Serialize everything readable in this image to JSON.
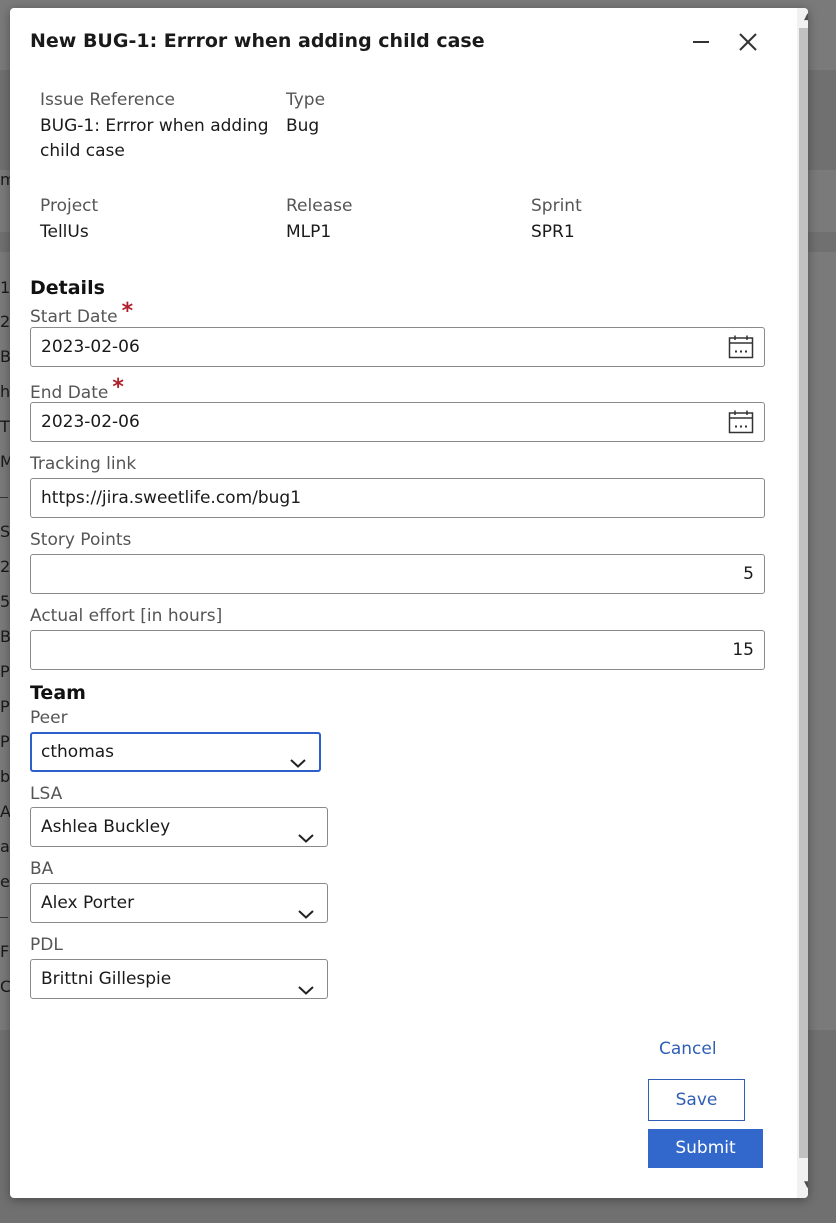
{
  "background": {
    "letters": [
      "m",
      "1",
      "2",
      "B",
      "h",
      "T",
      "M",
      "S",
      "2",
      "5",
      "B",
      "P",
      "P",
      "P",
      "b",
      "A",
      "a",
      "e",
      "F",
      "C"
    ]
  },
  "modal": {
    "title": "New BUG-1: Errror when adding child case",
    "minimize_icon": "minimize-icon",
    "close_icon": "close-icon"
  },
  "info": {
    "issue_reference_label": "Issue Reference",
    "issue_reference_value_line1": "BUG-1: Errror when adding",
    "issue_reference_value_line2": "child case",
    "type_label": "Type",
    "type_value": "Bug",
    "project_label": "Project",
    "project_value": "TellUs",
    "release_label": "Release",
    "release_value": "MLP1",
    "sprint_label": "Sprint",
    "sprint_value": "SPR1"
  },
  "details": {
    "section_title": "Details",
    "start_date_label": "Start Date",
    "start_date_value": "2023-02-06",
    "end_date_label": "End Date",
    "end_date_value": "2023-02-06",
    "required_marker": "*",
    "tracking_link_label": "Tracking link",
    "tracking_link_value": "https://jira.sweetlife.com/bug1",
    "story_points_label": "Story Points",
    "story_points_value": "5",
    "actual_effort_label": "Actual effort [in hours]",
    "actual_effort_value": "15"
  },
  "team": {
    "section_title": "Team",
    "peer_label": "Peer",
    "peer_value": "cthomas",
    "lsa_label": "LSA",
    "lsa_value": "Ashlea Buckley",
    "ba_label": "BA",
    "ba_value": "Alex Porter",
    "pdl_label": "PDL",
    "pdl_value": "Brittni Gillespie"
  },
  "actions": {
    "cancel_label": "Cancel",
    "save_label": "Save",
    "submit_label": "Submit"
  },
  "colors": {
    "accent": "#3268cc",
    "required": "#b0202a",
    "focus_border": "#2b5fc9"
  }
}
